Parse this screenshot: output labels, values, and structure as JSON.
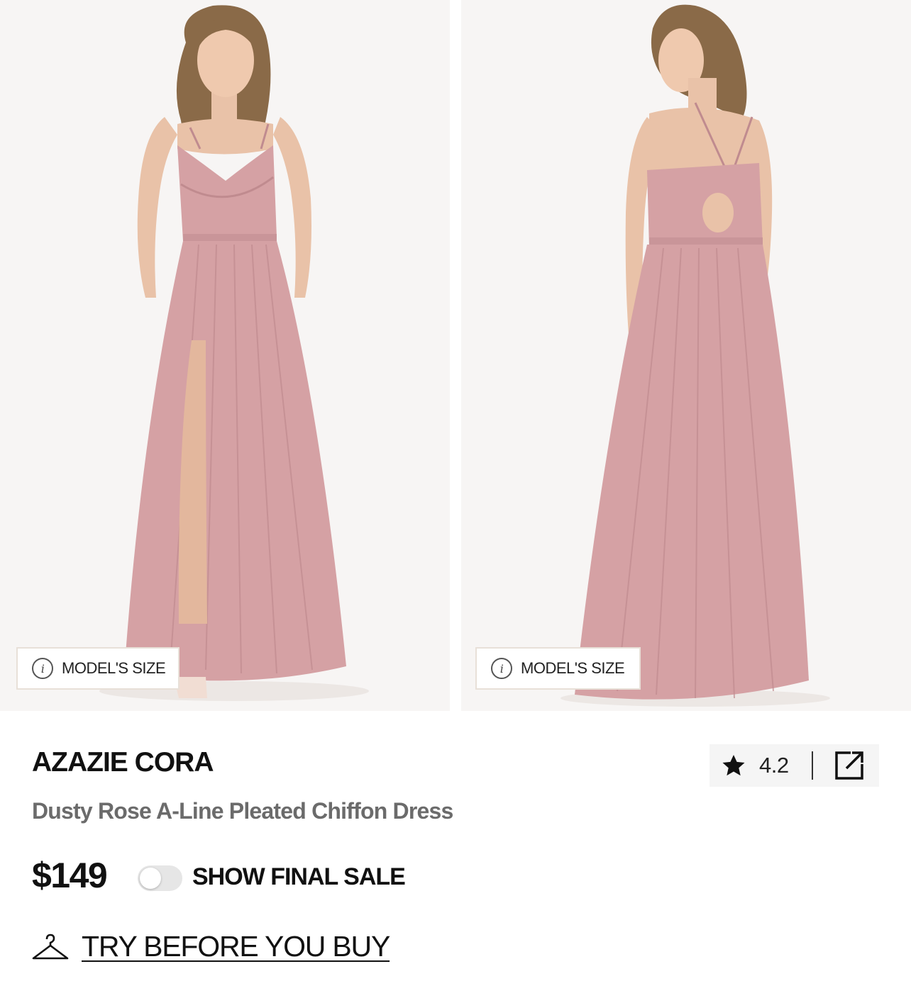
{
  "gallery": {
    "images": [
      {
        "alt": "front view",
        "model_size_label": "MODEL'S SIZE"
      },
      {
        "alt": "back view",
        "model_size_label": "MODEL'S SIZE"
      }
    ]
  },
  "product": {
    "brand_name": "AZAZIE CORA",
    "subtitle": "Dusty Rose A-Line Pleated Chiffon Dress",
    "price": "$149",
    "rating": "4.2"
  },
  "final_sale_toggle": {
    "label": "SHOW FINAL SALE",
    "on": false
  },
  "try_before": {
    "label": "TRY BEFORE YOU BUY"
  },
  "icons": {
    "info": "info-icon",
    "star": "star-icon",
    "share": "share-icon",
    "hanger": "hanger-icon"
  },
  "colors": {
    "dress": "#d5a1a4",
    "dress_shadow": "#c08b8f",
    "skin": "#e9c2a8",
    "hair": "#8a6a48",
    "toggle_off": "#e6e6e6",
    "subtitle": "#6b6b6b",
    "rating_bg": "#f5f5f5"
  }
}
